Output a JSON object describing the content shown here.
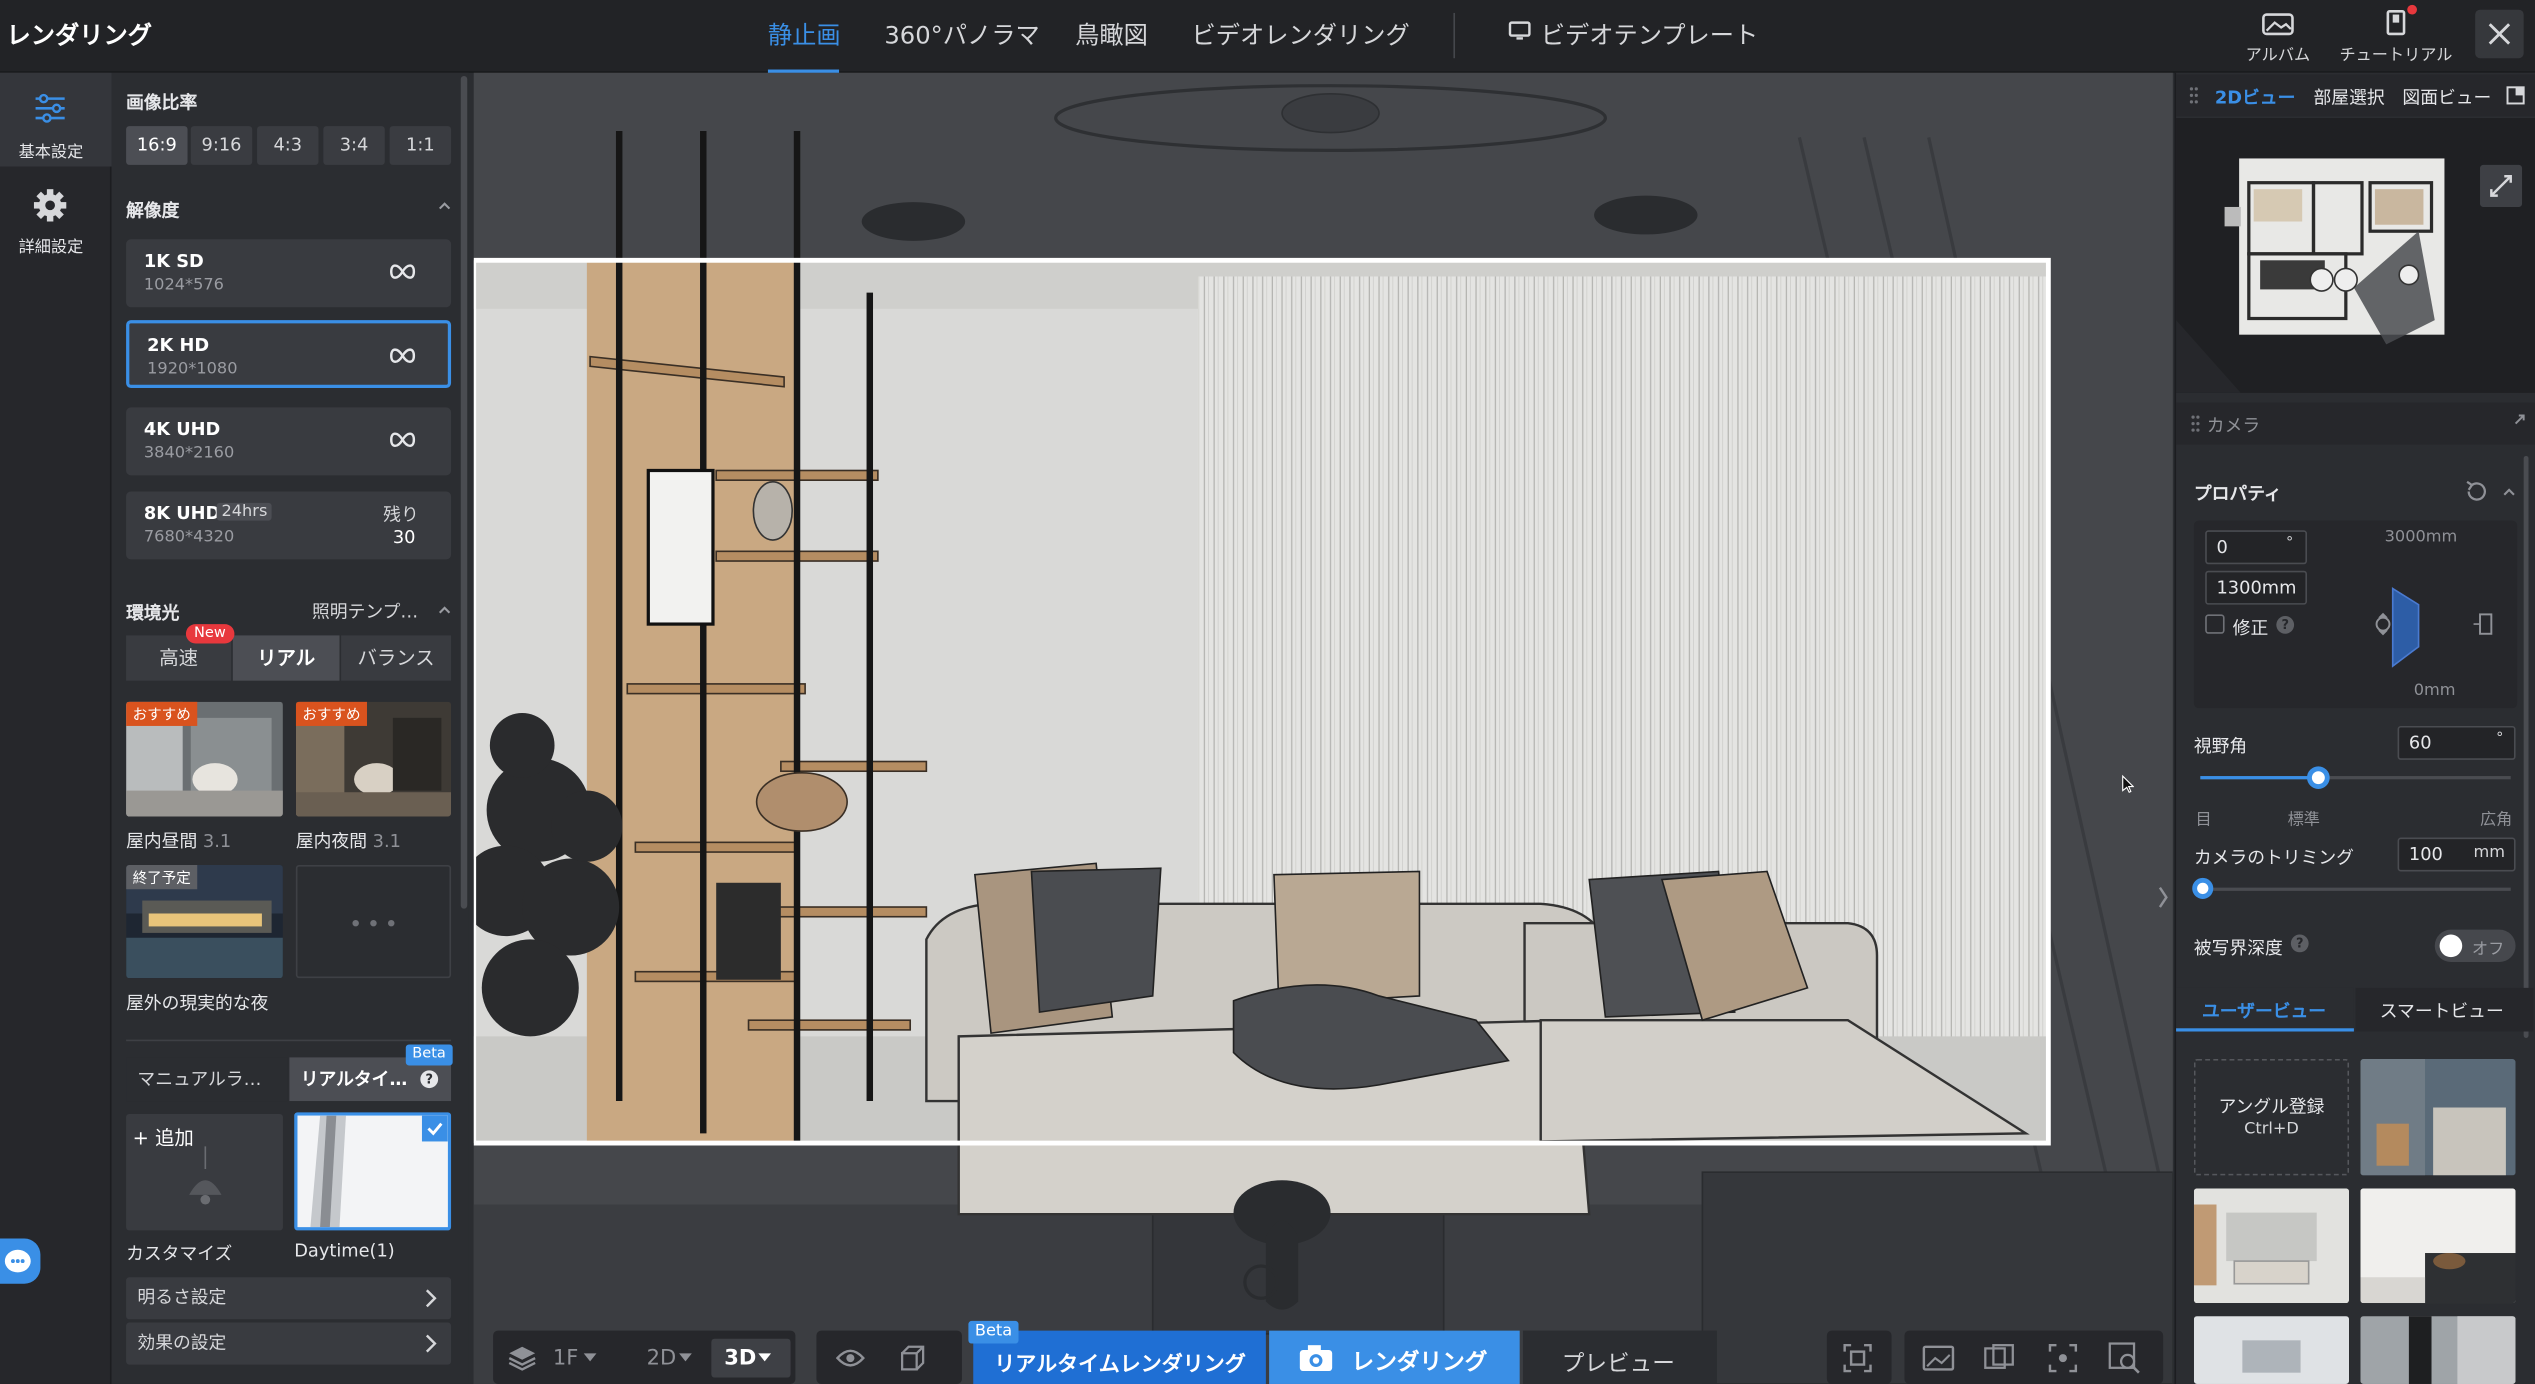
{
  "app": {
    "title": "レンダリング"
  },
  "tabs": [
    {
      "label": "静止画",
      "active": true
    },
    {
      "label": "360°パノラマ"
    },
    {
      "label": "鳥瞰図"
    },
    {
      "label": "ビデオレンダリング"
    },
    {
      "label": "ビデオテンプレート"
    }
  ],
  "topright": {
    "album": "アルバム",
    "tutorial": "チュートリアル"
  },
  "rail": {
    "basic": "基本設定",
    "advanced": "詳細設定"
  },
  "aspect": {
    "title": "画像比率",
    "options": [
      "16:9",
      "9:16",
      "4:3",
      "3:4",
      "1:1"
    ],
    "selected": "16:9"
  },
  "resolution": {
    "title": "解像度",
    "items": [
      {
        "name": "1K SD",
        "size": "1024*576"
      },
      {
        "name": "2K HD",
        "size": "1920*1080",
        "selected": true
      },
      {
        "name": "4K UHD",
        "size": "3840*2160"
      },
      {
        "name": "8K UHD",
        "size": "7680*4320",
        "badge": "24hrs",
        "remain_label": "残り",
        "remain": "30"
      }
    ]
  },
  "env": {
    "title": "環境光",
    "template": "照明テンプ…",
    "modes": [
      "高速",
      "リアル",
      "バランス"
    ],
    "new_badge": "New",
    "presets": [
      {
        "label": "屋内昼間",
        "ver": "3.1",
        "tag": "おすすめ"
      },
      {
        "label": "屋内夜間",
        "ver": "3.1",
        "tag": "おすすめ"
      },
      {
        "label": "屋外の現実的な夜",
        "tag": "終了予定"
      }
    ]
  },
  "light": {
    "tab_manual": "マニュアルラ…",
    "tab_realtime": "リアルタイ…",
    "beta": "Beta",
    "add": "+ 追加",
    "custom_label": "カスタマイズ",
    "daytime_label": "Daytime(1)",
    "brightness": "明るさ設定",
    "effect": "効果の設定"
  },
  "bottom": {
    "floor": "1F",
    "mode2d": "2D",
    "mode3d": "3D",
    "realtime_btn": "リアルタイムレンダリング",
    "beta": "Beta",
    "render_btn": "レンダリング",
    "preview": "プレビュー"
  },
  "right": {
    "view_tabs": [
      "2Dビュー",
      "部屋選択",
      "図面ビュー"
    ],
    "camera_title": "カメラ",
    "props_title": "プロパティ",
    "angle": "0",
    "angle_unit": "°",
    "height": "1300mm",
    "fix": "修正",
    "max_h": "3000mm",
    "min_h": "0mm",
    "fov_label": "視野角",
    "fov": "60",
    "fov_unit": "°",
    "fov_ticks": [
      "目",
      "標準",
      "広角"
    ],
    "fov_level": 0.38,
    "trim_label": "カメラのトリミング",
    "trim": "100",
    "trim_unit": "mm",
    "trim_level": 0.0,
    "dof_label": "被写界深度",
    "dof_state": "オフ",
    "user_tab": "ユーザービュー",
    "smart_tab": "スマートビュー",
    "angle_reg": "アングル登録",
    "angle_key": "Ctrl+D"
  }
}
